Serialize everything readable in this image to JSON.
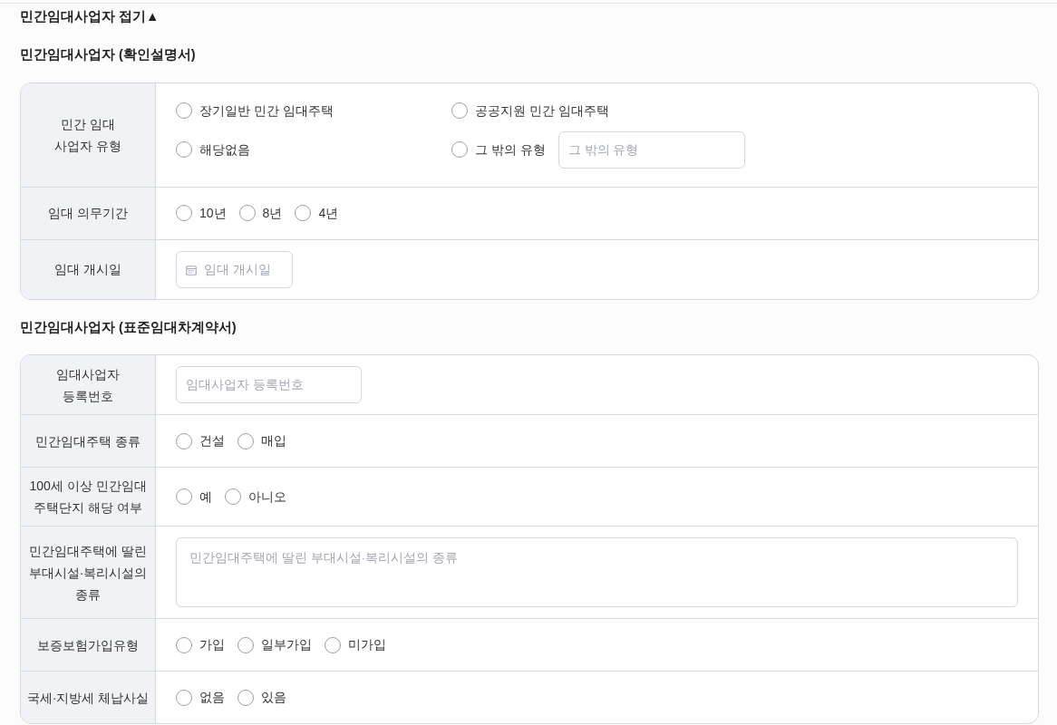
{
  "toggle": {
    "label": "민간임대사업자 접기",
    "arrow": "▲"
  },
  "sections": [
    {
      "title": "민간임대사업자 (확인설명서)",
      "rows": [
        {
          "label": "민간 임대\n사업자 유형",
          "kind": "radio-grid",
          "options": [
            {
              "label": "장기일반 민간 임대주택",
              "selected": false
            },
            {
              "label": "공공지원 민간 임대주택",
              "selected": false
            },
            {
              "label": "해당없음",
              "selected": false
            },
            {
              "label": "그 밖의 유형",
              "selected": false,
              "placeholder": "그 밖의 유형"
            }
          ]
        },
        {
          "label": "임대 의무기간",
          "kind": "radio",
          "options": [
            {
              "label": "10년",
              "selected": false
            },
            {
              "label": "8년",
              "selected": false
            },
            {
              "label": "4년",
              "selected": false
            }
          ]
        },
        {
          "label": "임대 개시일",
          "kind": "date",
          "placeholder": "임대 개시일"
        }
      ]
    },
    {
      "title": "민간임대사업자 (표준임대차계약서)",
      "rows": [
        {
          "label": "임대사업자\n등록번호",
          "kind": "text",
          "placeholder": "임대사업자 등록번호"
        },
        {
          "label": "민간임대주택 종류",
          "kind": "radio",
          "options": [
            {
              "label": "건설",
              "selected": false
            },
            {
              "label": "매입",
              "selected": false
            }
          ]
        },
        {
          "label": "100세 이상 민간임대\n주택단지 해당 여부",
          "kind": "radio",
          "options": [
            {
              "label": "예",
              "selected": false
            },
            {
              "label": "아니오",
              "selected": false
            }
          ]
        },
        {
          "label": "민간임대주택에 딸린\n부대시설·복리시설의\n종류",
          "kind": "textarea",
          "placeholder": "민간임대주택에 딸린 부대시설·복리시설의 종류"
        },
        {
          "label": "보증보험가입유형",
          "kind": "radio",
          "options": [
            {
              "label": "가입",
              "selected": false
            },
            {
              "label": "일부가입",
              "selected": false
            },
            {
              "label": "미가입",
              "selected": false
            }
          ]
        },
        {
          "label": "국세·지방세 체납사실",
          "kind": "radio",
          "options": [
            {
              "label": "없음",
              "selected": false
            },
            {
              "label": "있음",
              "selected": false
            }
          ]
        }
      ]
    }
  ]
}
